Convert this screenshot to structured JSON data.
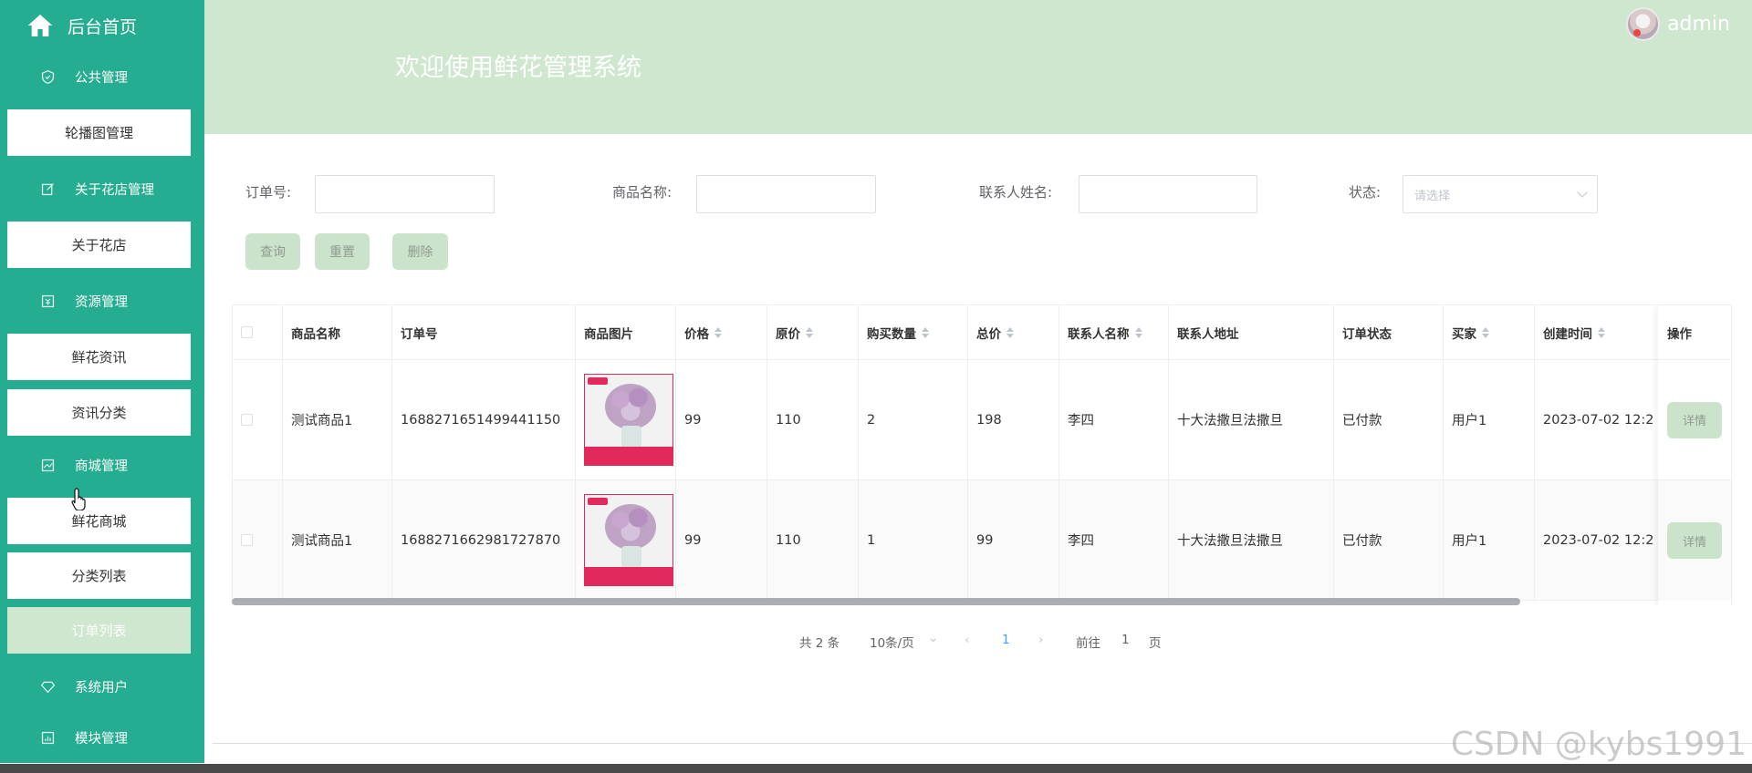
{
  "sidebar": {
    "home_label": "后台首页",
    "groups": [
      {
        "label": "公共管理",
        "icon": "shield-icon",
        "items": [
          "轮播图管理"
        ]
      },
      {
        "label": "关于花店管理",
        "icon": "edit-icon",
        "items": [
          "关于花店"
        ]
      },
      {
        "label": "资源管理",
        "icon": "image-icon",
        "items": [
          "鲜花资讯",
          "资讯分类"
        ]
      },
      {
        "label": "商城管理",
        "icon": "chart-icon",
        "items": [
          "鲜花商城",
          "分类列表",
          "订单列表"
        ]
      },
      {
        "label": "系统用户",
        "icon": "diamond-icon",
        "items": []
      },
      {
        "label": "模块管理",
        "icon": "bar-chart-icon",
        "items": []
      }
    ],
    "active_item": "订单列表"
  },
  "header": {
    "title": "欢迎使用鲜花管理系统",
    "username": "admin"
  },
  "filters": {
    "order_no_label": "订单号:",
    "goods_name_label": "商品名称:",
    "contact_name_label": "联系人姓名:",
    "status_label": "状态:",
    "status_placeholder": "请选择",
    "query_label": "查询",
    "reset_label": "重置",
    "delete_label": "删除"
  },
  "table": {
    "columns": [
      "商品名称",
      "订单号",
      "商品图片",
      "价格",
      "原价",
      "购买数量",
      "总价",
      "联系人名称",
      "联系人地址",
      "订单状态",
      "买家",
      "创建时间",
      "操作"
    ],
    "rows": [
      {
        "goods_name": "测试商品1",
        "order_no": "1688271651499441150",
        "price": "99",
        "original_price": "110",
        "quantity": "2",
        "total": "198",
        "contact_name": "李四",
        "address": "十大法撒旦法撒旦",
        "status": "已付款",
        "buyer": "用户1",
        "created": "2023-07-02 12:2",
        "action": "详情"
      },
      {
        "goods_name": "测试商品1",
        "order_no": "1688271662981727870",
        "price": "99",
        "original_price": "110",
        "quantity": "1",
        "total": "99",
        "contact_name": "李四",
        "address": "十大法撒旦法撒旦",
        "status": "已付款",
        "buyer": "用户1",
        "created": "2023-07-02 12:2",
        "action": "详情"
      }
    ]
  },
  "pagination": {
    "total_text": "共 2 条",
    "page_size_text": "10条/页",
    "current_page": "1",
    "goto_label": "前往",
    "goto_value": "1",
    "page_suffix": "页"
  },
  "watermark": "CSDN @kybs1991",
  "colors": {
    "sidebar": "#25ad92",
    "header": "#cfe6cf",
    "button": "#cbe3cb"
  }
}
